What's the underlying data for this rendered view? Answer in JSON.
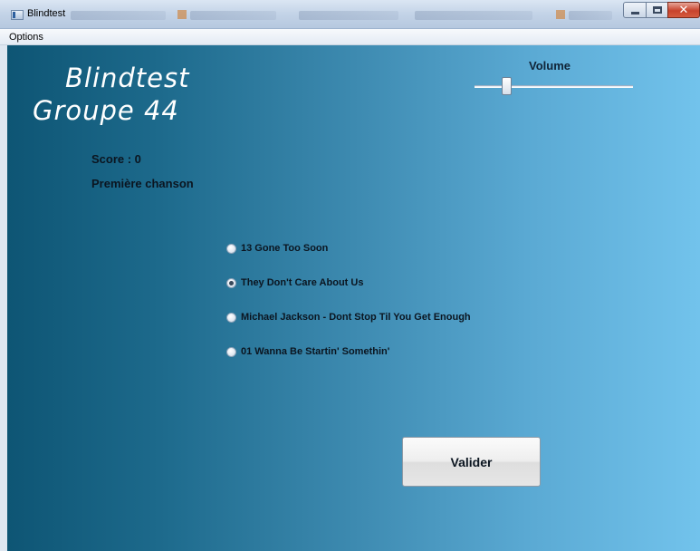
{
  "window": {
    "title": "Blindtest",
    "controls": {
      "minimize": "minimize",
      "maximize": "maximize",
      "close": "✕"
    }
  },
  "menu": {
    "items": [
      {
        "label": "Options"
      }
    ]
  },
  "app": {
    "title_line1": "Blindtest",
    "title_line2": "Groupe 44",
    "volume_label": "Volume",
    "volume_level": 0.18,
    "score_text": "Score : 0",
    "status_text": "Première chanson"
  },
  "choices": [
    {
      "label": "13 Gone Too Soon",
      "selected": false
    },
    {
      "label": "They Don't Care About Us",
      "selected": true
    },
    {
      "label": "Michael Jackson - Dont Stop Til You Get Enough",
      "selected": false
    },
    {
      "label": "01 Wanna Be Startin' Somethin'",
      "selected": false
    }
  ],
  "actions": {
    "submit_label": "Valider"
  }
}
